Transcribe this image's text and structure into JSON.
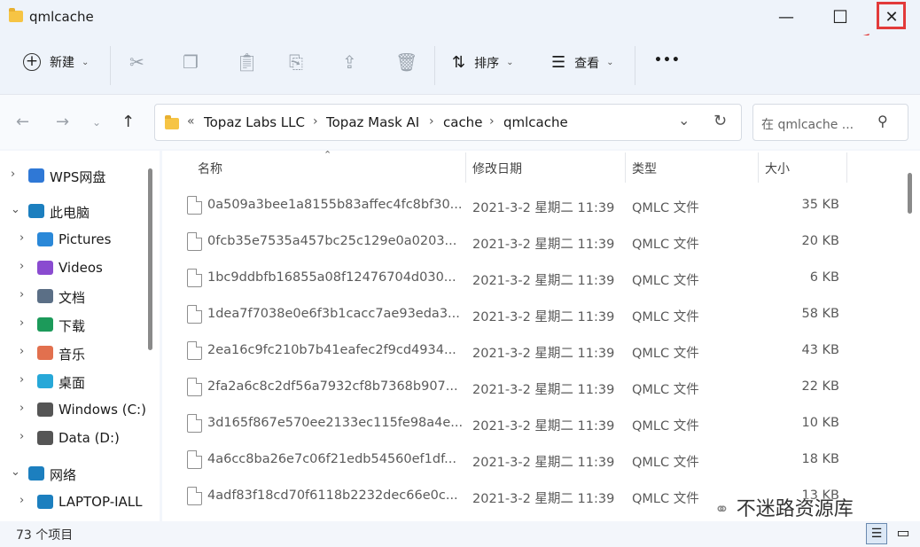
{
  "window": {
    "title": "qmlcache",
    "minimize": "—",
    "maximize": "☐",
    "close": "✕"
  },
  "toolbar": {
    "new_label": "新建",
    "sort_label": "排序",
    "view_label": "查看",
    "more_label": "•••"
  },
  "nav": {
    "breadcrumb_prefix": "«",
    "breadcrumbs": [
      "Topaz Labs LLC",
      "Topaz Mask AI",
      "cache",
      "qmlcache"
    ],
    "search_placeholder": "在 qmlcache ..."
  },
  "sidebar": {
    "items": [
      {
        "label": "WPS网盘",
        "icon": "cloud-icon",
        "color": "#2f78d6"
      },
      {
        "label": "此电脑",
        "icon": "computer-icon",
        "color": "#1c7fbf"
      },
      {
        "label": "Pictures",
        "icon": "pictures-icon",
        "color": "#2a88d8"
      },
      {
        "label": "Videos",
        "icon": "videos-icon",
        "color": "#8a4bd0"
      },
      {
        "label": "文档",
        "icon": "documents-icon",
        "color": "#5b6f86"
      },
      {
        "label": "下载",
        "icon": "download-icon",
        "color": "#1c9a5a"
      },
      {
        "label": "音乐",
        "icon": "music-icon",
        "color": "#e2704e"
      },
      {
        "label": "桌面",
        "icon": "desktop-icon",
        "color": "#27a8d8"
      },
      {
        "label": "Windows (C:)",
        "icon": "drive-icon",
        "color": "#555555"
      },
      {
        "label": "Data (D:)",
        "icon": "drive-icon",
        "color": "#555555"
      },
      {
        "label": "网络",
        "icon": "network-icon",
        "color": "#1c7fbf"
      },
      {
        "label": "LAPTOP-IALL",
        "icon": "laptop-icon",
        "color": "#1c7fbf"
      }
    ]
  },
  "columns": {
    "name": "名称",
    "date": "修改日期",
    "type": "类型",
    "size": "大小"
  },
  "files": [
    {
      "name": "0a509a3bee1a8155b83affec4fc8bf30...",
      "date": "2021-3-2 星期二 11:39",
      "type": "QMLC 文件",
      "size": "35 KB"
    },
    {
      "name": "0fcb35e7535a457bc25c129e0a0203...",
      "date": "2021-3-2 星期二 11:39",
      "type": "QMLC 文件",
      "size": "20 KB"
    },
    {
      "name": "1bc9ddbfb16855a08f12476704d030...",
      "date": "2021-3-2 星期二 11:39",
      "type": "QMLC 文件",
      "size": "6 KB"
    },
    {
      "name": "1dea7f7038e0e6f3b1cacc7ae93eda3...",
      "date": "2021-3-2 星期二 11:39",
      "type": "QMLC 文件",
      "size": "58 KB"
    },
    {
      "name": "2ea16c9fc210b7b41eafec2f9cd4934...",
      "date": "2021-3-2 星期二 11:39",
      "type": "QMLC 文件",
      "size": "43 KB"
    },
    {
      "name": "2fa2a6c8c2df56a7932cf8b7368b907...",
      "date": "2021-3-2 星期二 11:39",
      "type": "QMLC 文件",
      "size": "22 KB"
    },
    {
      "name": "3d165f867e570ee2133ec115fe98a4e...",
      "date": "2021-3-2 星期二 11:39",
      "type": "QMLC 文件",
      "size": "10 KB"
    },
    {
      "name": "4a6cc8ba26e7c06f21edb54560ef1df...",
      "date": "2021-3-2 星期二 11:39",
      "type": "QMLC 文件",
      "size": "18 KB"
    },
    {
      "name": "4adf83f18cd70f6118b2232dec66e0c...",
      "date": "2021-3-2 星期二 11:39",
      "type": "QMLC 文件",
      "size": "13 KB"
    }
  ],
  "status": {
    "count": "73 个项目"
  },
  "watermark": "不迷路资源库",
  "colors": {
    "highlight": "#e23a3a",
    "folder": "#f6c444"
  }
}
